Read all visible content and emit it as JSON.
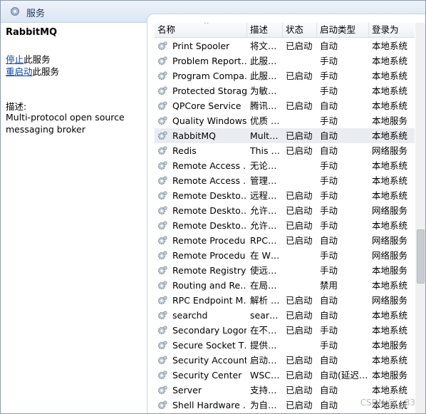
{
  "window": {
    "title": "服务",
    "icon": "gear-icon"
  },
  "left": {
    "selected_service": "RabbitMQ",
    "stop_link": "停止",
    "stop_suffix": "此服务",
    "restart_link": "重启动",
    "restart_suffix": "此服务",
    "description_label": "描述:",
    "description": "Multi-protocol open source messaging broker"
  },
  "table": {
    "columns": [
      "名称",
      "描述",
      "状态",
      "启动类型",
      "登录为"
    ],
    "sort_indicator": "^",
    "selected_index": 6,
    "rows": [
      [
        "Print Spooler",
        "将文…",
        "已启动",
        "自动",
        "本地系统"
      ],
      [
        "Problem Report…",
        "此服…",
        "",
        "手动",
        "本地系统"
      ],
      [
        "Program Compa…",
        "此服…",
        "已启动",
        "手动",
        "本地系统"
      ],
      [
        "Protected Storage",
        "为敏…",
        "",
        "手动",
        "本地系统"
      ],
      [
        "QPCore Service",
        "腾讯…",
        "已启动",
        "自动",
        "本地系统"
      ],
      [
        "Quality Windows…",
        "优质 …",
        "",
        "手动",
        "本地服务"
      ],
      [
        "RabbitMQ",
        "Mult…",
        "已启动",
        "自动",
        "本地系统"
      ],
      [
        "Redis",
        "This …",
        "已启动",
        "自动",
        "网络服务"
      ],
      [
        "Remote Access …",
        "无论…",
        "",
        "手动",
        "本地系统"
      ],
      [
        "Remote Access …",
        "管理…",
        "",
        "手动",
        "本地系统"
      ],
      [
        "Remote Deskto…",
        "远程…",
        "已启动",
        "手动",
        "本地系统"
      ],
      [
        "Remote Deskto…",
        "允许…",
        "已启动",
        "手动",
        "网络服务"
      ],
      [
        "Remote Deskto…",
        "允许…",
        "已启动",
        "手动",
        "本地系统"
      ],
      [
        "Remote Procedu…",
        "RPC…",
        "已启动",
        "自动",
        "网络服务"
      ],
      [
        "Remote Procedu…",
        "在 W…",
        "",
        "手动",
        "网络服务"
      ],
      [
        "Remote Registry",
        "使远…",
        "",
        "手动",
        "本地服务"
      ],
      [
        "Routing and Re…",
        "在局…",
        "",
        "禁用",
        "本地系统"
      ],
      [
        "RPC Endpoint M…",
        "解析 …",
        "已启动",
        "自动",
        "网络服务"
      ],
      [
        "searchd",
        "sear…",
        "已启动",
        "自动",
        "本地系统"
      ],
      [
        "Secondary Logon",
        "在不…",
        "已启动",
        "手动",
        "本地系统"
      ],
      [
        "Secure Socket T…",
        "提供…",
        "",
        "手动",
        "本地服务"
      ],
      [
        "Security Account…",
        "启动…",
        "已启动",
        "自动",
        "本地系统"
      ],
      [
        "Security Center",
        "WSC…",
        "已启动",
        "自动(延迟…",
        "本地服务"
      ],
      [
        "Server",
        "支持…",
        "已启动",
        "自动",
        "本地系统"
      ],
      [
        "Shell Hardware …",
        "为自…",
        "已启动",
        "自动",
        "本地系统"
      ]
    ]
  },
  "watermark": "CSDN @…83"
}
